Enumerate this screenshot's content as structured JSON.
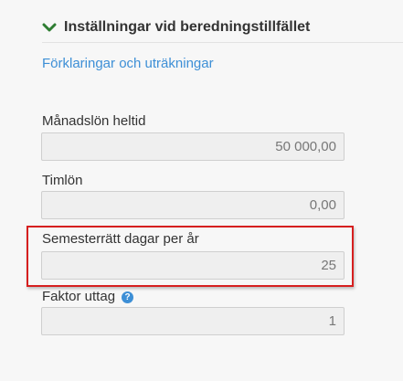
{
  "section": {
    "title": "Inställningar vid beredningstillfället",
    "icon": "chevron-down-icon",
    "accent_color": "#2e7d32"
  },
  "explanations_link": "Förklaringar och uträkningar",
  "fields": {
    "monthly_salary": {
      "label": "Månadslön heltid",
      "value": "50 000,00"
    },
    "hourly_wage": {
      "label": "Timlön",
      "value": "0,00"
    },
    "vacation_days": {
      "label": "Semesterrätt dagar per år",
      "value": "25"
    },
    "withdrawal_factor": {
      "label": "Faktor uttag",
      "value": "1",
      "help_icon": "?"
    }
  },
  "highlight_color": "#d61f1f"
}
